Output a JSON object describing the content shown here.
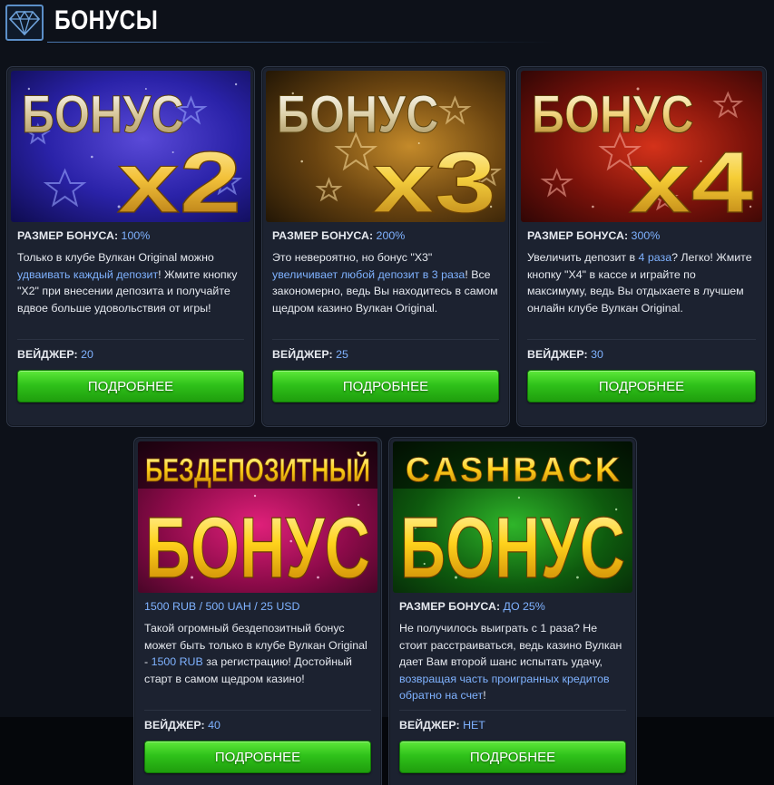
{
  "header": {
    "title": "БОНУСЫ",
    "icon": "diamond-icon",
    "accent": "#5b8fc8"
  },
  "colors": {
    "highlight": "#7fb2ff",
    "button": "#2fc21a",
    "card_bg": "#1c2230"
  },
  "cards": [
    {
      "banner": {
        "top": "БОНУС",
        "bottom": "x2",
        "theme": "blue"
      },
      "size_label": "РАЗМЕР БОНУСА:",
      "size_value": "100%",
      "desc": {
        "p1": "Только в клубе Вулкан Original можно ",
        "hl1": "удваивать каждый депозит",
        "p2": "! Жмите кнопку \"Х2\" при внесении депозита и получайте вдвое больше удовольствия от игры!"
      },
      "wager_label": "ВЕЙДЖЕР:",
      "wager_value": "20",
      "button": "ПОДРОБНЕЕ"
    },
    {
      "banner": {
        "top": "БОНУС",
        "bottom": "x3",
        "theme": "gold"
      },
      "size_label": "РАЗМЕР БОНУСА:",
      "size_value": "200%",
      "desc": {
        "p1": "Это невероятно, но бонус \"Х3\" ",
        "hl1": "увеличивает любой депозит в 3 раза",
        "p2": "! Все закономерно, ведь Вы находитесь в самом щедром казино Вулкан Original."
      },
      "wager_label": "ВЕЙДЖЕР:",
      "wager_value": "25",
      "button": "ПОДРОБНЕЕ"
    },
    {
      "banner": {
        "top": "БОНУС",
        "bottom": "x4",
        "theme": "red"
      },
      "size_label": "РАЗМЕР БОНУСА:",
      "size_value": "300%",
      "desc": {
        "p1": "Увеличить депозит в ",
        "hl1": "4 раза",
        "p2": "? Легко! Жмите кнопку \"Х4\" в кассе и играйте по максимуму, ведь Вы отдыхаете в лучшем онлайн клубе Вулкан Original."
      },
      "wager_label": "ВЕЙДЖЕР:",
      "wager_value": "30",
      "button": "ПОДРОБНЕЕ"
    },
    {
      "banner": {
        "top": "БЕЗДЕПОЗИТНЫЙ",
        "bottom": "БОНУС",
        "theme": "pink"
      },
      "size_label": "",
      "size_value": "1500 RUB / 500 UAH / 25 USD",
      "desc": {
        "p1": "Такой огромный бездепозитный бонус может быть только в клубе Вулкан Original - ",
        "hl1": "1500 RUB",
        "p2": " за регистрацию! Достойный старт в самом щедром казино!"
      },
      "wager_label": "ВЕЙДЖЕР:",
      "wager_value": "40",
      "button": "ПОДРОБНЕЕ"
    },
    {
      "banner": {
        "top": "CASHBACK",
        "bottom": "БОНУС",
        "theme": "green"
      },
      "size_label": "РАЗМЕР БОНУСА:",
      "size_value": "ДО 25%",
      "desc": {
        "p1": "Не получилось выиграть с 1 раза? Не стоит расстраиваться, ведь казино Вулкан дает Вам второй шанс испытать удачу, ",
        "hl1": "возвращая часть проигранных кредитов обратно на счет",
        "p2": "!"
      },
      "wager_label": "ВЕЙДЖЕР:",
      "wager_value": "НЕТ",
      "button": "ПОДРОБНЕЕ"
    }
  ]
}
